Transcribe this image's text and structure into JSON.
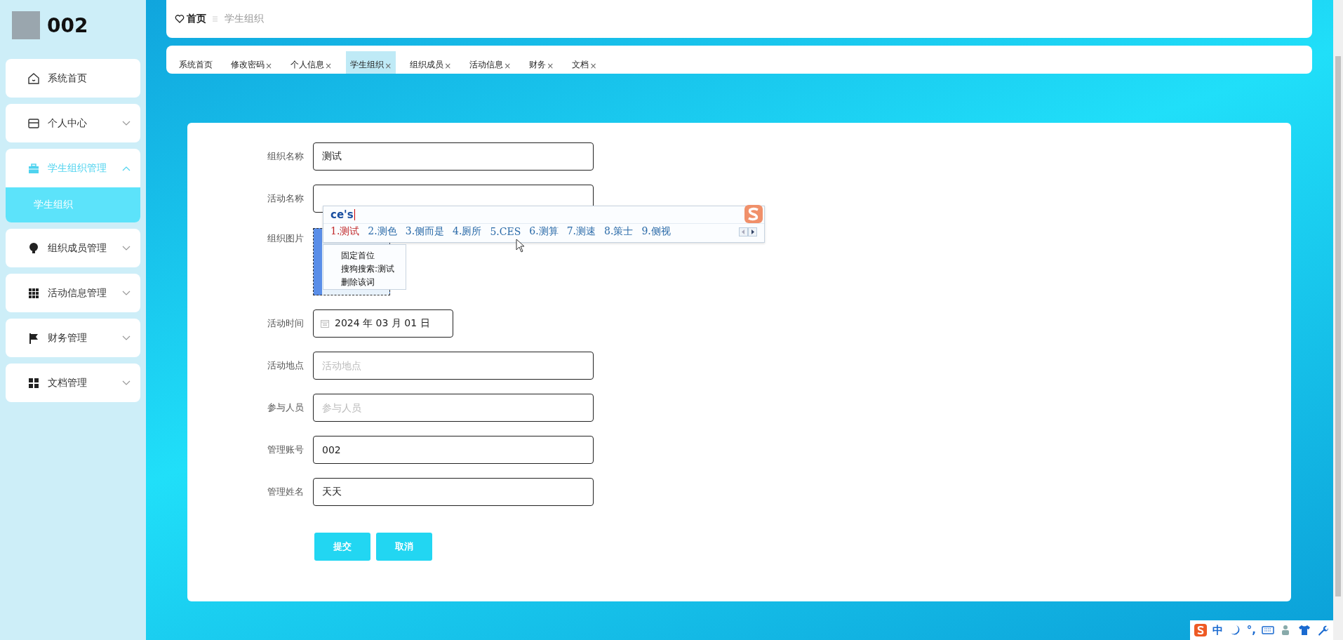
{
  "sidebar": {
    "user": {
      "name": "002"
    },
    "menu": [
      {
        "label": "系统首页",
        "expandable": false,
        "selected": false
      },
      {
        "label": "个人中心",
        "expandable": true,
        "expanded": false,
        "selected": false
      },
      {
        "label": "学生组织管理",
        "expandable": true,
        "expanded": true,
        "selected": true,
        "children": [
          {
            "label": "学生组织",
            "selected": true
          }
        ]
      },
      {
        "label": "组织成员管理",
        "expandable": true,
        "expanded": false,
        "selected": false
      },
      {
        "label": "活动信息管理",
        "expandable": true,
        "expanded": false,
        "selected": false
      },
      {
        "label": "财务管理",
        "expandable": true,
        "expanded": false,
        "selected": false
      },
      {
        "label": "文档管理",
        "expandable": true,
        "expanded": false,
        "selected": false
      }
    ]
  },
  "breadcrumb": {
    "home": "首页",
    "current": "学生组织"
  },
  "tabs": [
    {
      "label": "系统首页",
      "selected": false
    },
    {
      "label": "修改密码",
      "close": "×",
      "selected": false
    },
    {
      "label": "个人信息",
      "close": "×",
      "selected": false
    },
    {
      "label": "学生组织",
      "close": "×",
      "selected": true
    },
    {
      "label": "组织成员",
      "close": "×",
      "selected": false
    },
    {
      "label": "活动信息",
      "close": "×",
      "selected": false
    },
    {
      "label": "财务",
      "close": "×",
      "selected": false
    },
    {
      "label": "文档",
      "close": "×",
      "selected": false
    }
  ],
  "form": {
    "fields": [
      {
        "kind": "text",
        "label": "组织名称",
        "value": "测试"
      },
      {
        "kind": "text",
        "label": "活动名称"
      },
      {
        "kind": "image",
        "label": "组织图片"
      },
      {
        "kind": "date",
        "label": "活动时间",
        "value": "2024 年 03 月 01 日"
      },
      {
        "kind": "text",
        "label": "活动地点",
        "placeholder": "活动地点"
      },
      {
        "kind": "text",
        "label": "参与人员",
        "placeholder": "参与人员"
      },
      {
        "kind": "text",
        "label": "管理账号",
        "value": "002"
      },
      {
        "kind": "text",
        "label": "管理姓名",
        "value": "天天"
      }
    ],
    "buttons": [
      "提交",
      "取消"
    ]
  },
  "ime": {
    "composition": "ce's",
    "candidates": [
      {
        "label": "1.测试",
        "selected": true
      },
      {
        "label": "2.测色",
        "selected": false
      },
      {
        "label": "3.侧而是",
        "selected": false
      },
      {
        "label": "4.厕所",
        "selected": false
      },
      {
        "label": "5.CES",
        "selected": false
      },
      {
        "label": "6.测算",
        "selected": false
      },
      {
        "label": "7.测速",
        "selected": false
      },
      {
        "label": "8.策士",
        "selected": false
      },
      {
        "label": "9.侧视",
        "selected": false
      }
    ],
    "menu": [
      "固定首位",
      "搜狗搜索:测试",
      "删除该词"
    ]
  },
  "tray": {
    "mode": "中",
    "punctuation": "°,"
  }
}
